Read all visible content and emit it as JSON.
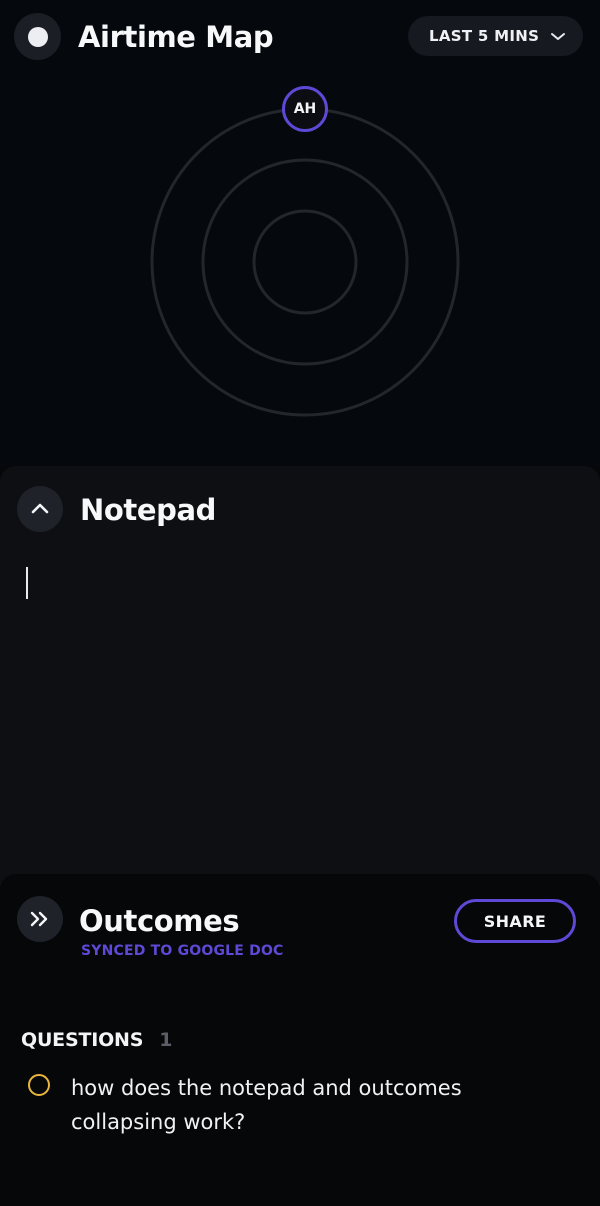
{
  "airtime": {
    "title": "Airtime Map",
    "range_label": "LAST 5 MINS",
    "avatar_initials": "AH",
    "record_icon": "record-icon",
    "chevron_icon": "chevron-down-icon"
  },
  "notepad": {
    "title": "Notepad",
    "content": "",
    "collapse_icon": "chevron-up-icon"
  },
  "outcomes": {
    "title": "Outcomes",
    "sync_status": "SYNCED TO GOOGLE DOC",
    "share_label": "SHARE",
    "expand_icon": "double-chevron-right-icon",
    "questions": {
      "label": "QUESTIONS",
      "count": "1",
      "items": [
        {
          "text": "how does the notepad and outcomes collapsing work?"
        }
      ]
    }
  },
  "colors": {
    "accent": "#5e49d6",
    "question_marker": "#e8b63d",
    "background": "#050709",
    "panel": "#0d0f13"
  }
}
